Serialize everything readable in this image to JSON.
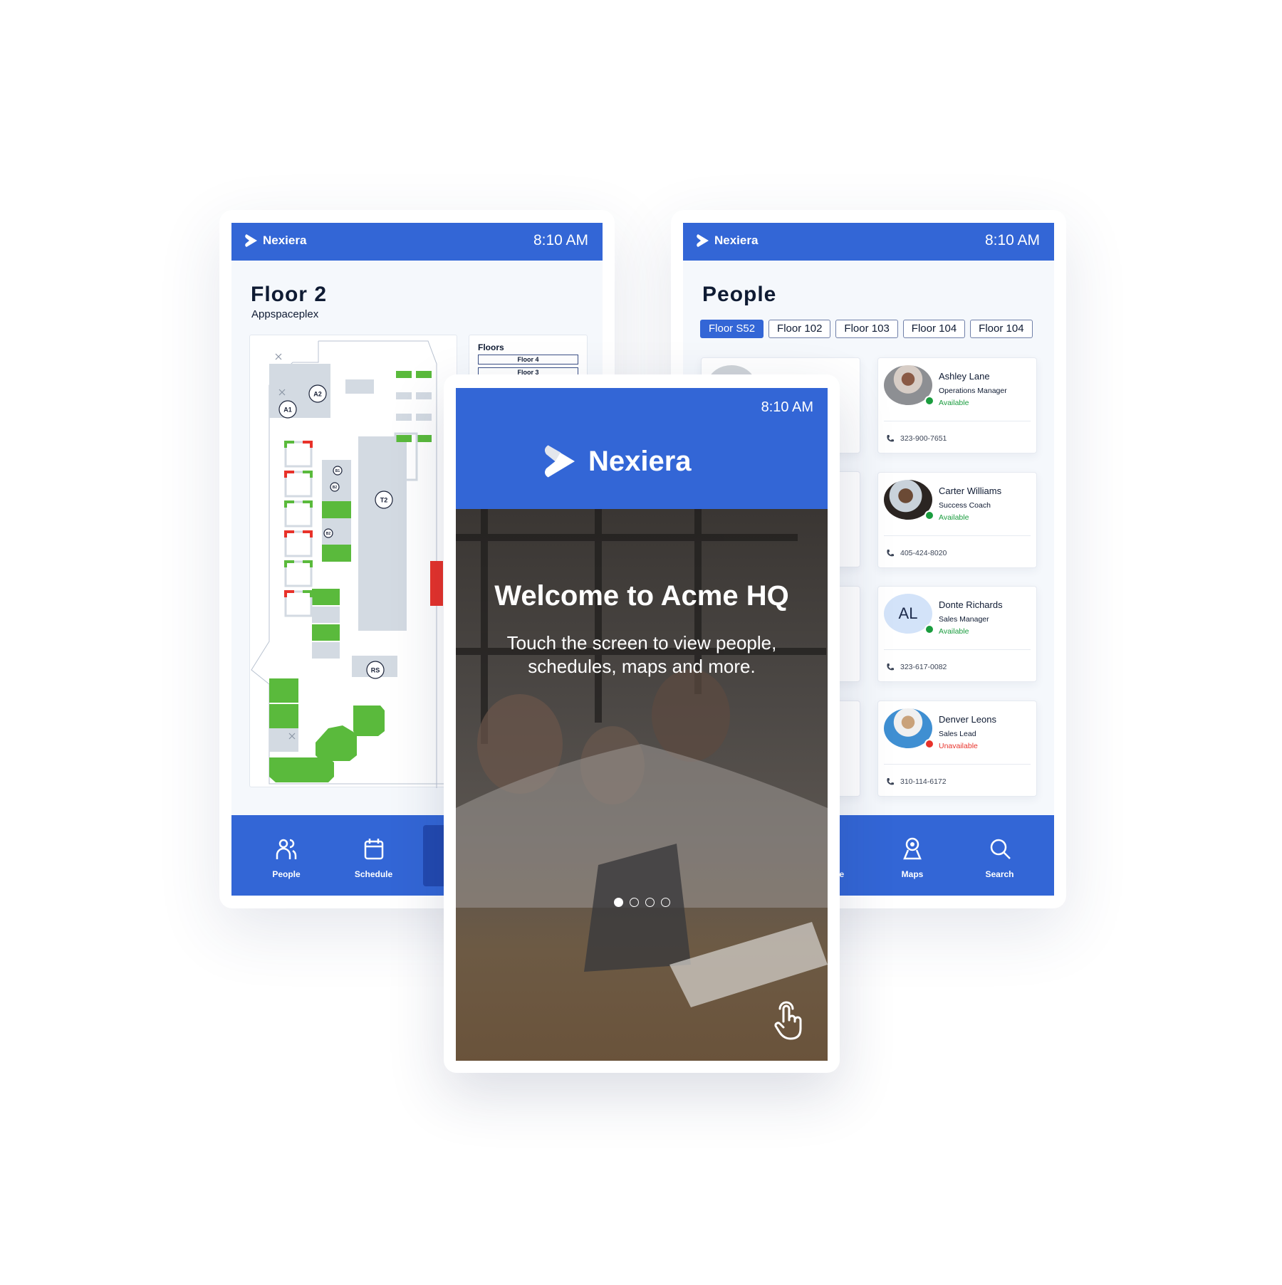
{
  "brand": "Nexiera",
  "time": "8:10 AM",
  "colors": {
    "primary": "#3366d6",
    "primary_dark": "#2249b0",
    "available": "#1a9c3e",
    "unavailable": "#e8322a",
    "map_green": "#5aba3c",
    "map_red": "#e8322a"
  },
  "map_screen": {
    "title": "Floor 2",
    "subtitle": "Appspaceplex",
    "floors": {
      "heading": "Floors",
      "items": [
        "Floor 4",
        "Floor 3"
      ]
    },
    "map_labels": [
      "A1",
      "A2",
      "B1",
      "B2",
      "B2",
      "T2",
      "RS"
    ]
  },
  "people_screen": {
    "title": "People",
    "tabs": [
      {
        "label": "Floor S52",
        "active": true
      },
      {
        "label": "Floor 102"
      },
      {
        "label": "Floor 103"
      },
      {
        "label": "Floor 104"
      },
      {
        "label": "Floor 104"
      }
    ],
    "people": [
      {
        "name": "Ashley Lane",
        "role": "Operations Manager",
        "status": "Available",
        "phone": "323-900-7651",
        "avatar": "photo"
      },
      {
        "name": "Carter Williams",
        "role": "Success Coach",
        "status": "Available",
        "phone": "405-424-8020",
        "avatar": "photo"
      },
      {
        "name": "Donte Richards",
        "role": "Sales Manager",
        "status": "Available",
        "phone": "323-617-0082",
        "initials": "AL"
      },
      {
        "name": "Denver Leons",
        "role": "Sales Lead",
        "status": "Unavailable",
        "phone": "310-114-6172",
        "avatar": "photo"
      }
    ]
  },
  "nav": [
    {
      "label": "People",
      "icon": "people-icon"
    },
    {
      "label": "Schedule",
      "icon": "calendar-icon"
    },
    {
      "label": "Maps",
      "icon": "map-pin-icon"
    },
    {
      "label": "Search",
      "icon": "search-icon"
    }
  ],
  "welcome": {
    "title": "Welcome to Acme HQ",
    "subtitle": "Touch the screen to view people, schedules, maps and more.",
    "slides": 4,
    "active_slide": 1,
    "touch_icon": "hand-pointer-icon"
  }
}
